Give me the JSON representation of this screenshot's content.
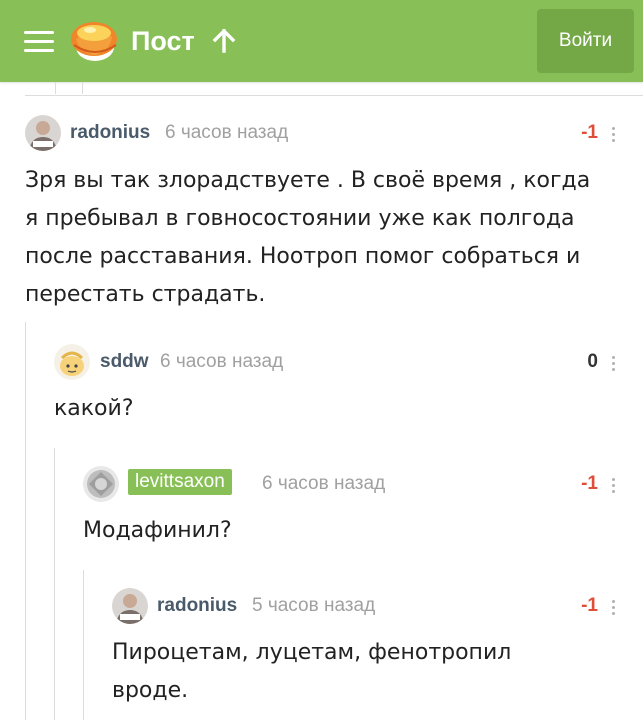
{
  "header": {
    "title": "Пост",
    "login_label": "Войти",
    "background_color": "#88c057",
    "menu_icon": "hamburger-menu-icon",
    "logo_icon": "pikabu-cupcake-logo",
    "up_icon": "arrow-up-icon"
  },
  "comments": [
    {
      "username": "radonius",
      "time": "6 часов назад",
      "rating": "-1",
      "avatar_icon": "user-photo-avatar",
      "text": "Зря вы так злорадствуете . В своё время , когда я пребывал в говносостоянии уже как полгода после расставания. Ноотроп помог собраться и перестать страдать."
    },
    {
      "username": "sddw",
      "time": "6 часов назад",
      "rating": "0",
      "avatar_icon": "drawn-face-avatar",
      "text": "какой?"
    },
    {
      "username": "levittsaxon",
      "time": "6 часов назад",
      "rating": "-1",
      "avatar_icon": "gray-badge-avatar",
      "author_badge": true,
      "text": "Модафинил?"
    },
    {
      "username": "radonius",
      "time": "5 часов назад",
      "rating": "-1",
      "avatar_icon": "user-photo-avatar",
      "text": "Пироцетам, луцетам, фенотропил вроде."
    }
  ],
  "colors": {
    "negative_rating": "#e04e39",
    "username": "#4a5a6a",
    "timestamp": "#a0a0a0",
    "accent_green": "#88c057"
  }
}
